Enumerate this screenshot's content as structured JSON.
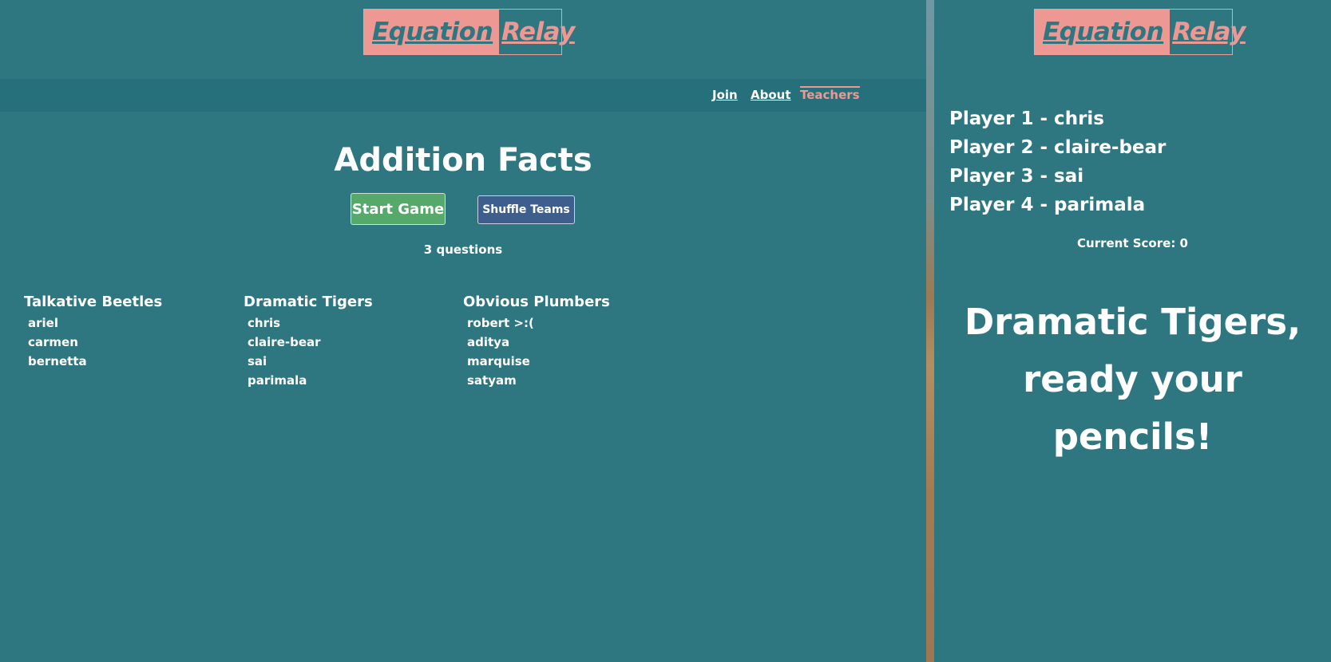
{
  "brand": {
    "word1": "Equation",
    "word2": "Relay"
  },
  "nav": {
    "join": "Join",
    "about": "About",
    "teachers": "Teachers"
  },
  "game": {
    "title": "Addition Facts",
    "start_label": "Start Game",
    "shuffle_label": "Shuffle Teams",
    "question_count": "3 questions"
  },
  "teams": [
    {
      "name": "Talkative Beetles",
      "members": [
        "ariel",
        "carmen",
        "bernetta"
      ]
    },
    {
      "name": "Dramatic Tigers",
      "members": [
        "chris",
        "claire-bear",
        "sai",
        "parimala"
      ]
    },
    {
      "name": "Obvious Plumbers",
      "members": [
        "robert >:(",
        "aditya",
        "marquise",
        "satyam"
      ]
    }
  ],
  "player_view": {
    "players": [
      "Player 1 - chris",
      "Player 2 - claire-bear",
      "Player 3 - sai",
      "Player 4 - parimala"
    ],
    "score": "Current Score: 0",
    "message_line1": "Dramatic Tigers,",
    "message_line2": "ready your pencils!"
  },
  "colors": {
    "background": "#2f7780",
    "navbar": "#25707a",
    "accent_pink": "#ee9894",
    "start_green": "#56a86b",
    "shuffle_blue": "#3e5f8e"
  }
}
